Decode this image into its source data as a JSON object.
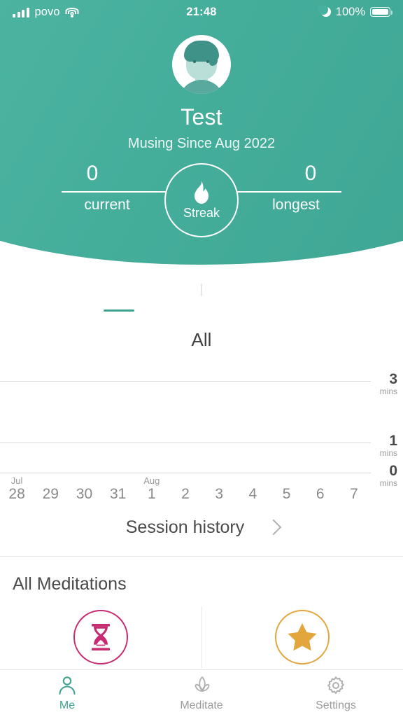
{
  "status_bar": {
    "carrier": "povo",
    "signal_icon": "cellular-bars-icon",
    "wifi_icon": "wifi-icon",
    "time": "21:48",
    "moon_icon": "moon-icon",
    "battery_percent": "100%",
    "battery_icon": "battery-full-icon"
  },
  "header": {
    "avatar_icon": "user-avatar",
    "name": "Test",
    "since": "Musing Since Aug 2022",
    "accent_color": "#45ae9b"
  },
  "streak": {
    "flame_icon": "flame-icon",
    "center_label": "Streak",
    "current_value": "0",
    "current_label": "current",
    "longest_value": "0",
    "longest_label": "longest"
  },
  "chart_tabs": [
    {
      "icon": "donut-chart-icon",
      "name": "tab-stats-donut",
      "selected": true
    },
    {
      "icon": "brain-icon",
      "name": "tab-stats-brain",
      "selected": false
    },
    {
      "icon": "clock-icon",
      "name": "tab-stats-clock",
      "selected": false
    }
  ],
  "chart_data": {
    "type": "bar",
    "title": "All",
    "xlabel": "",
    "ylabel": "mins",
    "categories": [
      "28",
      "29",
      "30",
      "31",
      "1",
      "2",
      "3",
      "4",
      "5",
      "6",
      "7"
    ],
    "month_labels": [
      "Jul",
      "",
      "",
      "",
      "Aug",
      "",
      "",
      "",
      "",
      "",
      ""
    ],
    "values": [
      0,
      0,
      0,
      0,
      0,
      0,
      0,
      0,
      0,
      0,
      0
    ],
    "ylim": [
      0,
      3
    ],
    "yticks": [
      0,
      1,
      3
    ],
    "ytick_labels": [
      "0",
      "1",
      "3"
    ],
    "ytick_unit": "mins",
    "grid": true,
    "legend": false
  },
  "session_history": {
    "label": "Session history",
    "chevron_icon": "chevron-right-icon"
  },
  "all_meditations": {
    "title": "All Meditations",
    "items": [
      {
        "icon": "hourglass-icon",
        "name": "meditation-timed",
        "color": "#c72b72"
      },
      {
        "icon": "star-icon",
        "name": "meditation-favorites",
        "color": "#e2a63c"
      }
    ]
  },
  "bottom_nav": {
    "active_color": "#3fa392",
    "inactive_color": "#9b9b9b",
    "items": [
      {
        "label": "Me",
        "icon": "person-icon",
        "active": true
      },
      {
        "label": "Meditate",
        "icon": "lotus-icon",
        "active": false
      },
      {
        "label": "Settings",
        "icon": "gear-icon",
        "active": false
      }
    ]
  }
}
